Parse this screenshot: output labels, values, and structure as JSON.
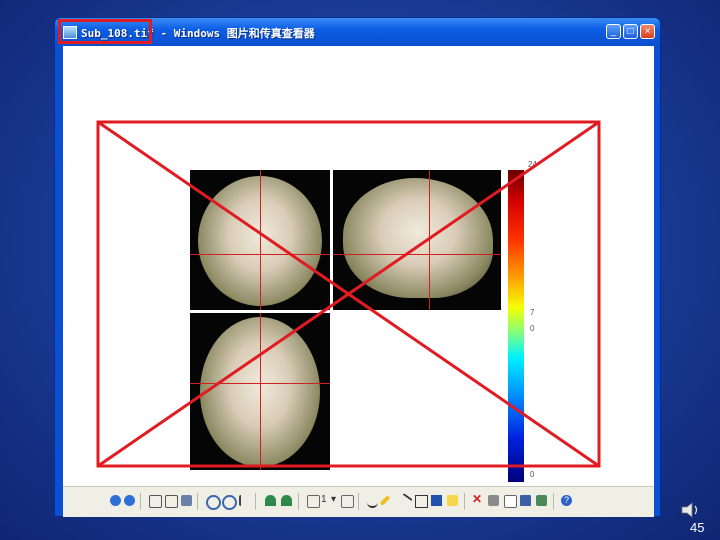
{
  "window": {
    "title": "Sub_108.tif - Windows 图片和传真查看器",
    "controls": [
      "minimize",
      "maximize",
      "close"
    ]
  },
  "colorbar": {
    "labels": [
      "24",
      "7",
      "0",
      "0"
    ]
  },
  "toolbar": {
    "page_number": "1",
    "icons": [
      "prev-image-icon",
      "next-image-icon",
      "best-fit-icon",
      "actual-size-icon",
      "slideshow-icon",
      "zoom-in-icon",
      "zoom-out-icon",
      "select-icon",
      "annotate-icon",
      "annotate-2-icon",
      "prev-page-icon",
      "next-page-icon",
      "freehand-icon",
      "highlighter-icon",
      "line-icon",
      "rectangle-icon",
      "filled-rectangle-icon",
      "note-icon",
      "delete-icon",
      "print-icon",
      "copy-icon",
      "save-icon",
      "open-editor-icon",
      "help-icon"
    ]
  },
  "slide": {
    "page_number": "45"
  },
  "colors": {
    "highlight": "#e11b22",
    "cross": "#e11b22"
  }
}
